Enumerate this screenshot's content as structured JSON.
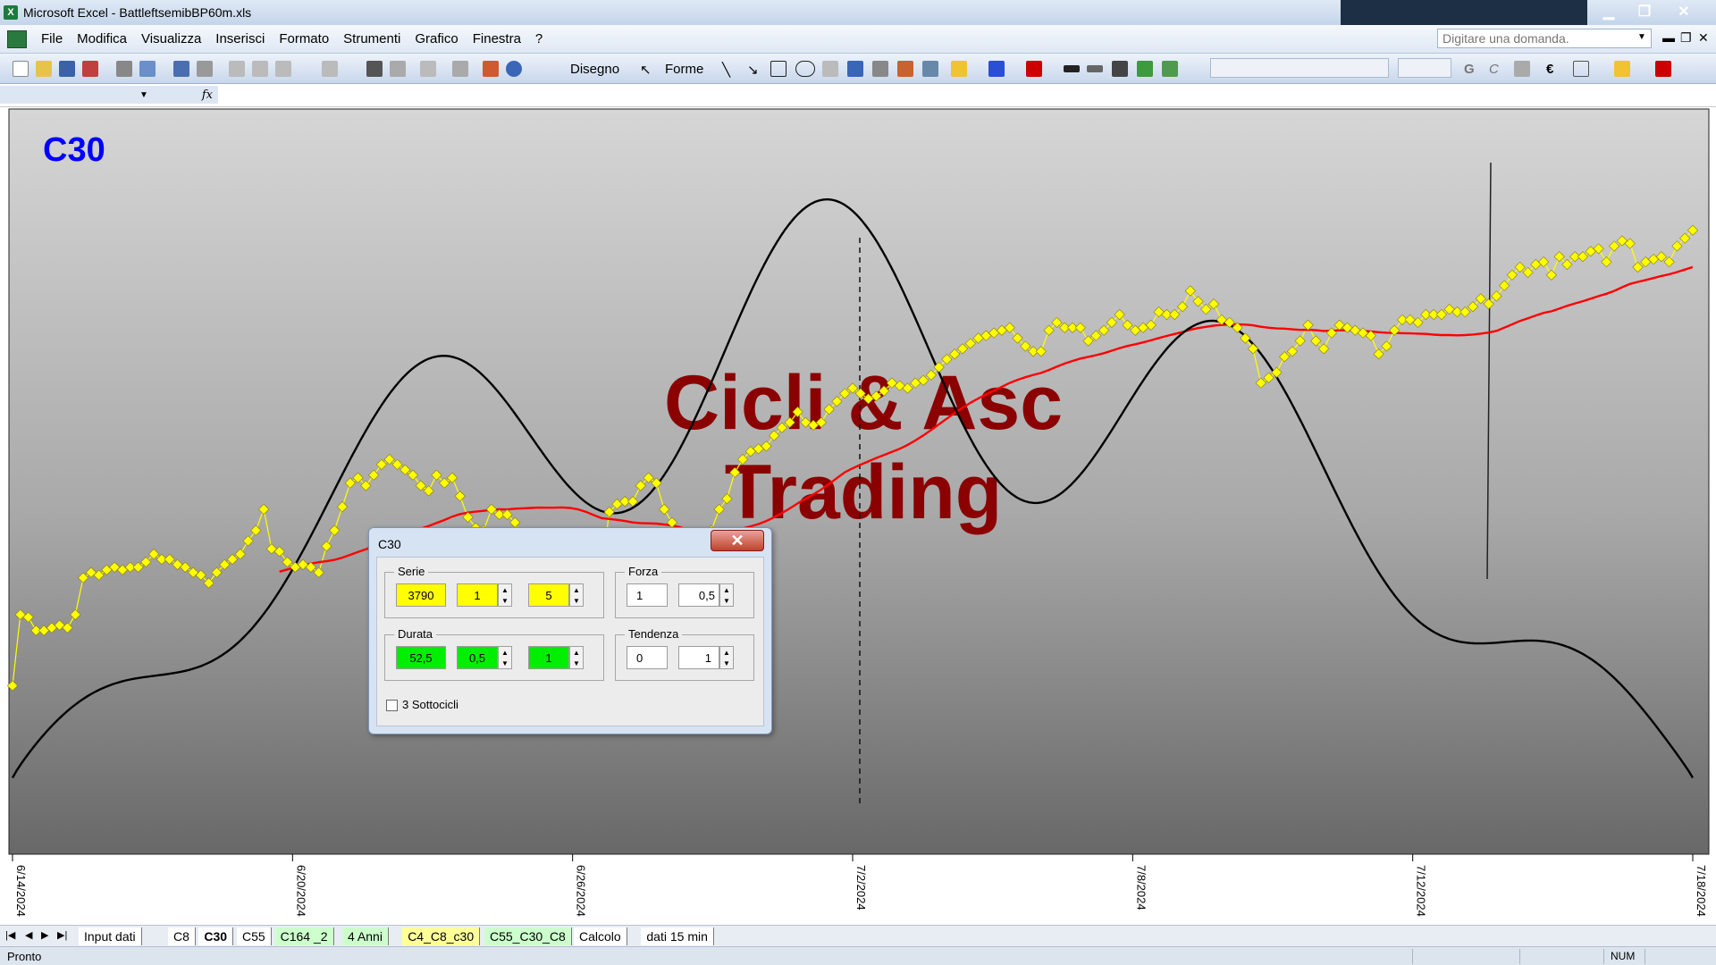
{
  "window": {
    "app": "Microsoft Excel",
    "filename": "BattleftsemibBP60m.xls",
    "title": "Microsoft Excel - BattleftsemibBP60m.xls"
  },
  "menu": {
    "items": [
      "File",
      "Modifica",
      "Visualizza",
      "Inserisci",
      "Formato",
      "Strumenti",
      "Grafico",
      "Finestra",
      "?"
    ],
    "ask_placeholder": "Digitare una domanda."
  },
  "toolbar": {
    "drawing_label": "Disegno",
    "shapes_label": "Forme"
  },
  "formula_bar": {
    "name_box": "",
    "fx_label": "fx"
  },
  "chart": {
    "label": "C30",
    "watermark_line1": "Cicli & Asc",
    "watermark_line2": "Trading",
    "x_ticks": [
      "6/14/2024",
      "6/20/2024",
      "6/26/2024",
      "7/2/2024",
      "7/8/2024",
      "7/12/2024",
      "7/18/2024"
    ],
    "colors": {
      "price": "#ffff00",
      "average": "#ff0000",
      "cycle": "#000000",
      "watermark": "#8b0000",
      "label": "#0000ff"
    }
  },
  "chart_data": {
    "type": "line",
    "title": "C30",
    "xlabel": "",
    "ylabel": "",
    "x_ticks": [
      "6/14/2024",
      "6/20/2024",
      "6/26/2024",
      "7/2/2024",
      "7/8/2024",
      "7/12/2024",
      "7/18/2024"
    ],
    "series": [
      {
        "type": "line-markers",
        "color": "#ffff00",
        "values": [
          0.45,
          0.72,
          0.71,
          0.66,
          0.66,
          0.67,
          0.68,
          0.67,
          0.72,
          0.86,
          0.88,
          0.87,
          0.89,
          0.9,
          0.89,
          0.9,
          0.9,
          0.92,
          0.95,
          0.93,
          0.93,
          0.91,
          0.9,
          0.88,
          0.87,
          0.84,
          0.88,
          0.91,
          0.93,
          0.95,
          1.0,
          1.04,
          1.12,
          0.97,
          0.96,
          0.92,
          0.9,
          0.91,
          0.9,
          0.88,
          0.98,
          1.04,
          1.13,
          1.22,
          1.24,
          1.21,
          1.25,
          1.29,
          1.31,
          1.29,
          1.27,
          1.25,
          1.21,
          1.19,
          1.25,
          1.22,
          1.24,
          1.17,
          1.09,
          1.05,
          1.04,
          1.12,
          1.1,
          1.1,
          1.07,
          1.0,
          0.96,
          0.94,
          0.9,
          0.9,
          0.91,
          0.92,
          0.88,
          0.85,
          0.83,
          0.88,
          1.11,
          1.14,
          1.15,
          1.15,
          1.21,
          1.24,
          1.22,
          1.12,
          1.07,
          1.03,
          0.98,
          0.99,
          1.03,
          1.04,
          1.12,
          1.16,
          1.26,
          1.31,
          1.34,
          1.35,
          1.36,
          1.4,
          1.43,
          1.45,
          1.49,
          1.45,
          1.44,
          1.45,
          1.5,
          1.53,
          1.56,
          1.58,
          1.56,
          1.54,
          1.55,
          1.57,
          1.6,
          1.59,
          1.58,
          1.6,
          1.61,
          1.63,
          1.66,
          1.69,
          1.71,
          1.73,
          1.75,
          1.77,
          1.78,
          1.79,
          1.8,
          1.81,
          1.77,
          1.74,
          1.72,
          1.72,
          1.8,
          1.83,
          1.81,
          1.81,
          1.81,
          1.76,
          1.78,
          1.8,
          1.83,
          1.86,
          1.82,
          1.8,
          1.81,
          1.82,
          1.87,
          1.86,
          1.86,
          1.89,
          1.95,
          1.91,
          1.88,
          1.9,
          1.84,
          1.83,
          1.81,
          1.77,
          1.73,
          1.6,
          1.62,
          1.64,
          1.7,
          1.72,
          1.76,
          1.82,
          1.76,
          1.73,
          1.79,
          1.82,
          1.81,
          1.8,
          1.79,
          1.78,
          1.71,
          1.74,
          1.8,
          1.84,
          1.84,
          1.83,
          1.86,
          1.86,
          1.86,
          1.88,
          1.87,
          1.87,
          1.89,
          1.92,
          1.9,
          1.93,
          1.97,
          2.01,
          2.04,
          2.02,
          2.05,
          2.06,
          2.01,
          2.08,
          2.05,
          2.08,
          2.08,
          2.1,
          2.11,
          2.06,
          2.12,
          2.14,
          2.13,
          2.04,
          2.06,
          2.07,
          2.08,
          2.06,
          2.12,
          2.15,
          2.18
        ]
      },
      {
        "type": "line",
        "color": "#ff0000"
      },
      {
        "type": "line",
        "color": "#000000"
      }
    ]
  },
  "dialog": {
    "title": "C30",
    "close_label": "✕",
    "serie": {
      "label": "Serie",
      "value1": "3790",
      "value2": "1",
      "value3": "5"
    },
    "forza": {
      "label": "Forza",
      "value1": "1",
      "value2": "0,5"
    },
    "durata": {
      "label": "Durata",
      "value1": "52,5",
      "value2": "0,5",
      "value3": "1"
    },
    "tendenza": {
      "label": "Tendenza",
      "value1": "0",
      "value2": "1"
    },
    "subcycles_label": "3 Sottocicli"
  },
  "sheet_tabs": [
    {
      "label": "Input dati",
      "active": false,
      "color": "#ffffff"
    },
    {
      "label": "C8",
      "active": false,
      "color": "#ffffff"
    },
    {
      "label": "C30",
      "active": true,
      "color": "#ffffff"
    },
    {
      "label": "C55",
      "active": false,
      "color": "#ffffff"
    },
    {
      "label": "C164 _2",
      "active": false,
      "color": "#ccffcc"
    },
    {
      "label": "4 Anni",
      "active": false,
      "color": "#ccffcc"
    },
    {
      "label": "C4_C8_c30",
      "active": false,
      "color": "#ffff99"
    },
    {
      "label": "C55_C30_C8",
      "active": false,
      "color": "#ccffcc"
    },
    {
      "label": "Calcolo",
      "active": false,
      "color": "#ffffff"
    },
    {
      "label": "dati 15 min",
      "active": false,
      "color": "#ffffff"
    }
  ],
  "status": {
    "text": "Pronto",
    "num": "NUM"
  }
}
